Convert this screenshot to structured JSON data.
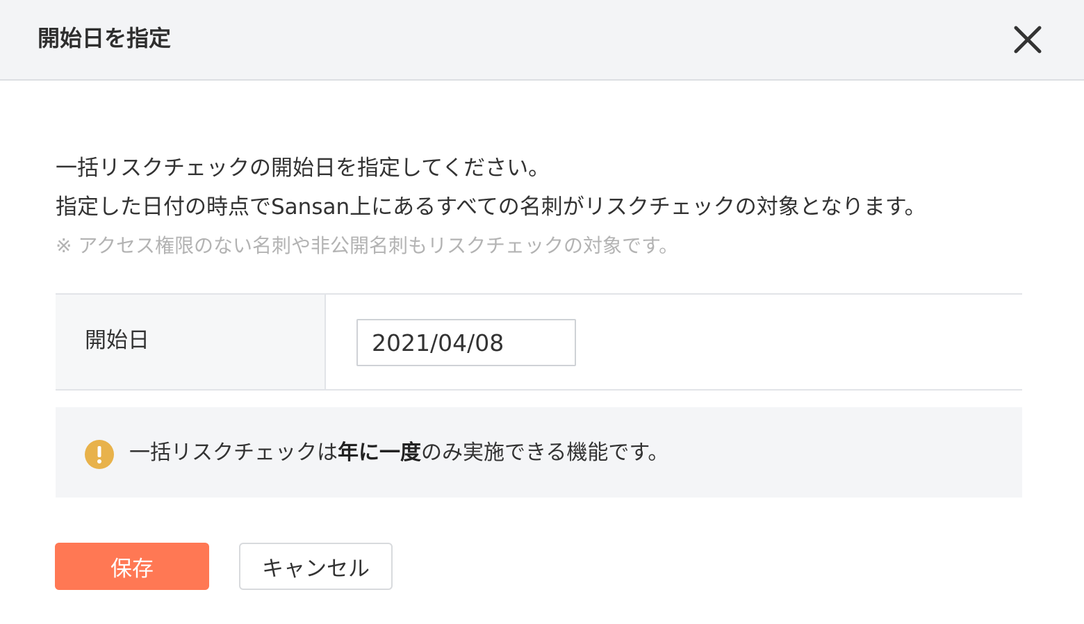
{
  "dialog": {
    "title": "開始日を指定",
    "close_icon": "close-icon"
  },
  "description": {
    "line1": "一括リスクチェックの開始日を指定してください。",
    "line2": "指定した日付の時点でSansan上にあるすべての名刺がリスクチェックの対象となります。",
    "note": "※ アクセス権限のない名刺や非公開名刺もリスクチェックの対象です。"
  },
  "form": {
    "start_date_label": "開始日",
    "start_date_value": "2021/04/08"
  },
  "notice": {
    "icon": "warning-icon",
    "text_before": "一括リスクチェックは",
    "text_bold": "年に一度",
    "text_after": "のみ実施できる機能です。"
  },
  "buttons": {
    "save_label": "保存",
    "cancel_label": "キャンセル"
  },
  "colors": {
    "primary": "#ff7854",
    "warning": "#e8b24b",
    "header_bg": "#f3f4f6",
    "note_text": "#b3b3b3"
  }
}
